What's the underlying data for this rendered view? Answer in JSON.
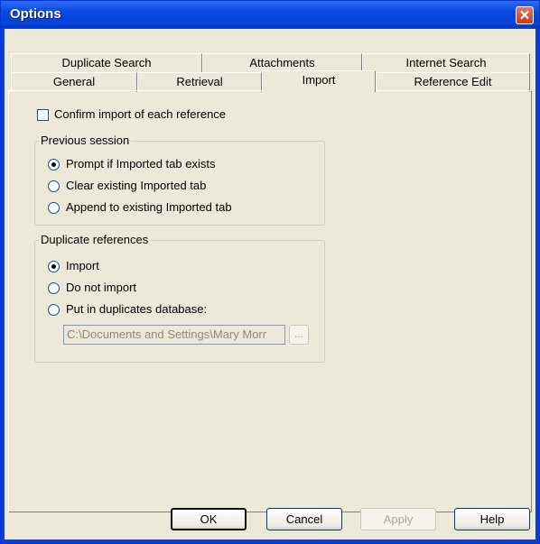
{
  "window": {
    "title": "Options",
    "close_glyph": "✕"
  },
  "tabs_row1": [
    "Duplicate Search",
    "Attachments",
    "Internet Search"
  ],
  "tabs_row2": [
    "General",
    "Retrieval",
    "Import",
    "Reference Edit"
  ],
  "active_tab": "Import",
  "import": {
    "confirm_label": "Confirm import of each reference",
    "confirm_checked": false,
    "previous_session": {
      "title": "Previous session",
      "options": [
        "Prompt if Imported tab exists",
        "Clear existing Imported tab",
        "Append to existing Imported tab"
      ],
      "selected": "Prompt if Imported tab exists"
    },
    "duplicate_refs": {
      "title": "Duplicate references",
      "options": [
        "Import",
        "Do not import",
        "Put in duplicates database:"
      ],
      "selected": "Import",
      "path_value": "C:\\Documents and Settings\\Mary Morr",
      "browse_label": "..."
    }
  },
  "buttons": {
    "ok": "OK",
    "cancel": "Cancel",
    "apply": "Apply",
    "help": "Help"
  }
}
